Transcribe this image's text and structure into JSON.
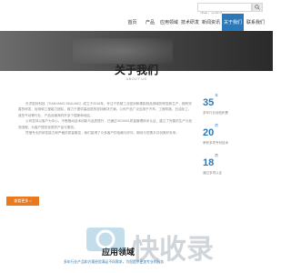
{
  "header": {
    "search_placeholder": "请输入关键词",
    "search_icon": "search-icon"
  },
  "nav": {
    "items": [
      {
        "label": "首页"
      },
      {
        "label": "产品"
      },
      {
        "label": "应用领域"
      },
      {
        "label": "技术研发"
      },
      {
        "label": "新闻资讯"
      },
      {
        "label": "关于我们"
      },
      {
        "label": "联系我们"
      }
    ],
    "active_color": "#2c78b8"
  },
  "about": {
    "title": "关于我们",
    "subtitle": "ABOUT US",
    "paragraphs": [
      "天洋密封科技（TIANYANG SEALING）成立于2016年，专注于机械工业密封和橡胶制品领域的研发和生产，拥有完善的研发、检测和工程能力团队，致力于提供高品质的密封解决方案。公司产品广泛应用于汽车、工程机械、石油化工、液压气动等行业，产品远销海内外多个国家和地区。",
      "公司坚持以客户为中心，不断推动技术创新与品质提升，已通过ISO9001质量管理体系认证，建立了完善的生产与检测流程，为客户提供优质的产品与服务。",
      "凭借专业的研发能力和严格的质量管控，我们赢得了众多客户的信赖与好评，期待与您携手共创美好未来。"
    ],
    "more_label": "查看更多 >"
  },
  "stats": [
    {
      "value": "35",
      "unit": "年",
      "desc": "多年行业经验积累"
    },
    {
      "value": "20",
      "unit": "项",
      "desc": "荣获多项专利技术"
    },
    {
      "value": "18",
      "unit": "项",
      "desc": "通过多项认证"
    }
  ],
  "watermark": {
    "text_big": "快收录",
    "text_small": "应用领域",
    "subline": "多年行业产品和方案经验满足不同需求，为您提供更加专业的服务"
  }
}
